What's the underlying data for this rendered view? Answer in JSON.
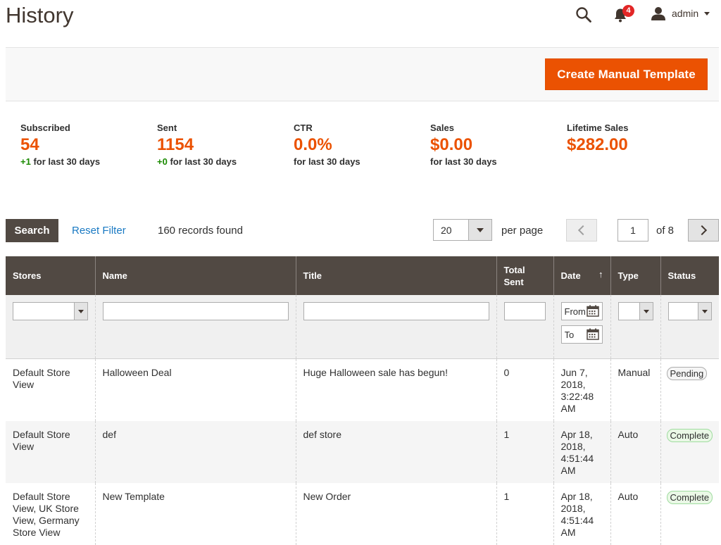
{
  "header": {
    "title": "History",
    "user_name": "admin",
    "notifications_count": "4"
  },
  "actions": {
    "create_label": "Create Manual Template"
  },
  "stats": [
    {
      "label": "Subscribed",
      "value": "54",
      "delta": "+1",
      "sub": " for last 30 days"
    },
    {
      "label": "Sent",
      "value": "1154",
      "delta": "+0",
      "sub": " for last 30 days"
    },
    {
      "label": "CTR",
      "value": "0.0%",
      "delta": "",
      "sub": "for last 30 days"
    },
    {
      "label": "Sales",
      "value": "$0.00",
      "delta": "",
      "sub": "for last 30 days"
    },
    {
      "label": "Lifetime Sales",
      "value": "$282.00",
      "delta": "",
      "sub": ""
    }
  ],
  "toolbar": {
    "search_label": "Search",
    "reset_label": "Reset Filter",
    "records_text": "160 records found",
    "per_page_value": "20",
    "per_page_label": "per page",
    "current_page": "1",
    "of_pages": "of 8"
  },
  "grid": {
    "columns": [
      "Stores",
      "Name",
      "Title",
      "Total Sent",
      "Date",
      "Type",
      "Status"
    ],
    "sort_indicator": "↑",
    "date_from_placeholder": "From",
    "date_to_placeholder": "To",
    "rows": [
      {
        "stores": "Default Store View",
        "name": "Halloween Deal",
        "title": "Huge Halloween sale has begun!",
        "total_sent": "0",
        "date": "Jun 7, 2018, 3:22:48 AM",
        "type": "Manual",
        "status": "Pending"
      },
      {
        "stores": "Default Store View",
        "name": "def",
        "title": "def store",
        "total_sent": "1",
        "date": "Apr 18, 2018, 4:51:44 AM",
        "type": "Auto",
        "status": "Complete"
      },
      {
        "stores": "Default Store View, UK Store View, Germany Store View",
        "name": "New Template",
        "title": "New Order",
        "total_sent": "1",
        "date": "Apr 18, 2018, 4:51:44 AM",
        "type": "Auto",
        "status": "Complete"
      }
    ]
  },
  "colors": {
    "accent": "#eb5202",
    "header_bg": "#514943",
    "link": "#1979c3",
    "positive": "#1a8a00"
  }
}
